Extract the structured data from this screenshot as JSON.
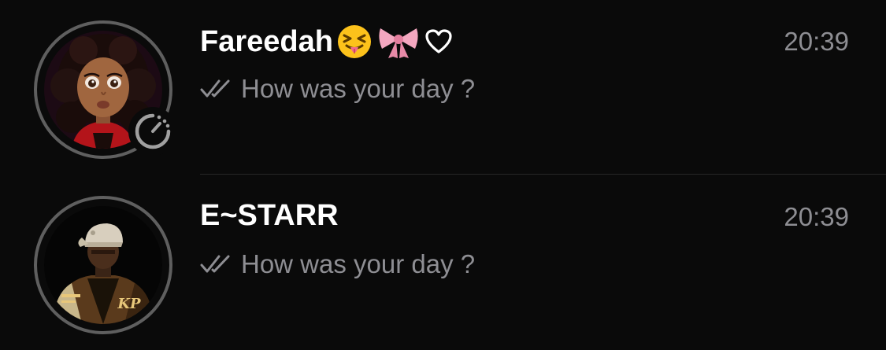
{
  "chats": [
    {
      "name": "Fareedah",
      "name_emojis": [
        "squinting-face-with-tongue",
        "pink-ribbon-bow",
        "white-heart"
      ],
      "time": "20:39",
      "preview": "How was your day ?",
      "read_receipt": "double-check-icon",
      "has_status": true,
      "status_icon": "status-timer-icon",
      "avatar": "girl-with-curly-hair-avatar"
    },
    {
      "name": "E~STARR",
      "time": "20:39",
      "preview": "How was your day ?",
      "read_receipt": "double-check-icon",
      "has_status": false,
      "avatar": "man-in-varsity-jacket-avatar",
      "avatar_jacket_text": "KP"
    }
  ],
  "colors": {
    "background": "#0a0a0a",
    "name_text": "#ffffff",
    "secondary_text": "#8e8e93",
    "avatar_ring": "#5f5f5f",
    "divider": "#262626"
  }
}
